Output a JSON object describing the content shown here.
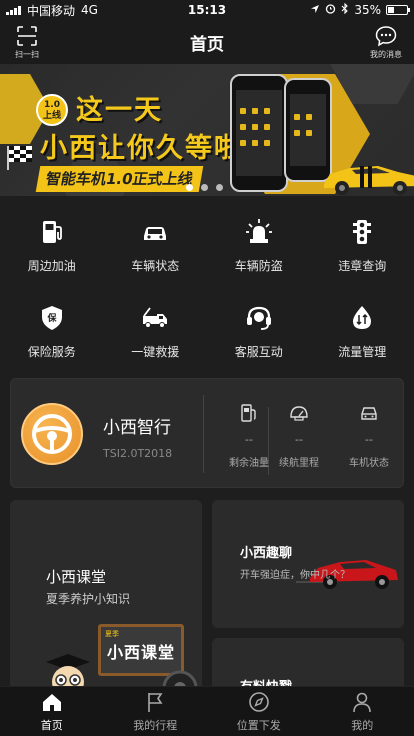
{
  "status_bar": {
    "carrier": "中国移动",
    "network": "4G",
    "time": "15:13",
    "battery": "35%"
  },
  "nav": {
    "title": "首页",
    "scan_label": "扫一扫",
    "messages_label": "我的消息"
  },
  "banner": {
    "badge": "1.0 上线",
    "badge_line1": "1.0",
    "badge_line2": "上线",
    "headline_line1": "这一天",
    "headline_line2": "小西让你久等啦",
    "ribbon": "智能车机1.0正式上线",
    "slide_count": 3,
    "active_slide": 0
  },
  "services": [
    {
      "label": "周边加油",
      "icon": "gas-station-icon"
    },
    {
      "label": "车辆状态",
      "icon": "car-status-icon"
    },
    {
      "label": "车辆防盗",
      "icon": "alarm-light-icon"
    },
    {
      "label": "违章查询",
      "icon": "traffic-light-icon"
    },
    {
      "label": "保险服务",
      "icon": "insurance-shield-icon"
    },
    {
      "label": "一键救援",
      "icon": "tow-truck-icon"
    },
    {
      "label": "客服互动",
      "icon": "headset-icon"
    },
    {
      "label": "流量管理",
      "icon": "data-flow-icon"
    }
  ],
  "vehicle": {
    "name": "小西智行",
    "model": "TSI2.0T2018",
    "stats": [
      {
        "value": "--",
        "label": "剩余油量",
        "icon": "fuel-pump-icon"
      },
      {
        "value": "--",
        "label": "续航里程",
        "icon": "speedometer-icon"
      },
      {
        "value": "--",
        "label": "车机状态",
        "icon": "car-front-icon"
      }
    ]
  },
  "cards": {
    "class_title": "小西课堂",
    "class_subtitle": "夏季养护小知识",
    "class_board_tag": "夏季",
    "class_board_text": "小西课堂",
    "chat_title": "小西趣聊",
    "chat_subtitle": "开车强迫症，你中几个？",
    "news_title": "有料快戳"
  },
  "tabs": [
    {
      "label": "首页",
      "icon": "home-icon",
      "active": true
    },
    {
      "label": "我的行程",
      "icon": "flag-icon",
      "active": false
    },
    {
      "label": "位置下发",
      "icon": "compass-icon",
      "active": false
    },
    {
      "label": "我的",
      "icon": "user-icon",
      "active": false
    }
  ],
  "colors": {
    "accent": "#f3c318",
    "background": "#1e1e1e",
    "card": "#2b2b2b"
  }
}
